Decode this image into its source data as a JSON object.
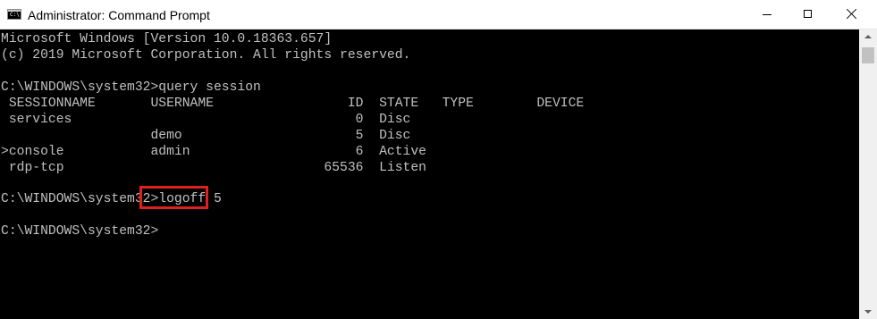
{
  "window": {
    "title": "Administrator: Command Prompt",
    "app_icon_glyph": "C:\\",
    "controls": {
      "minimize": "minimize-icon",
      "maximize": "maximize-icon",
      "close": "close-icon"
    }
  },
  "console": {
    "text_color": "#c0c0c0",
    "background_color": "#000000",
    "highlight_color": "#e02020",
    "lines": [
      "Microsoft Windows [Version 10.0.18363.657]",
      "(c) 2019 Microsoft Corporation. All rights reserved.",
      "",
      "C:\\WINDOWS\\system32>query session",
      " SESSIONNAME       USERNAME                 ID  STATE   TYPE        DEVICE",
      " services                                    0  Disc",
      "                   demo                      5  Disc",
      ">console           admin                     6  Active",
      " rdp-tcp                                 65536  Listen",
      "",
      "C:\\WINDOWS\\system32>logoff 5",
      "",
      "C:\\WINDOWS\\system32>"
    ],
    "highlighted_command": "logoff 5"
  },
  "scrollbar": {
    "up_arrow": "scroll-up-icon",
    "down_arrow": "scroll-down-icon"
  }
}
